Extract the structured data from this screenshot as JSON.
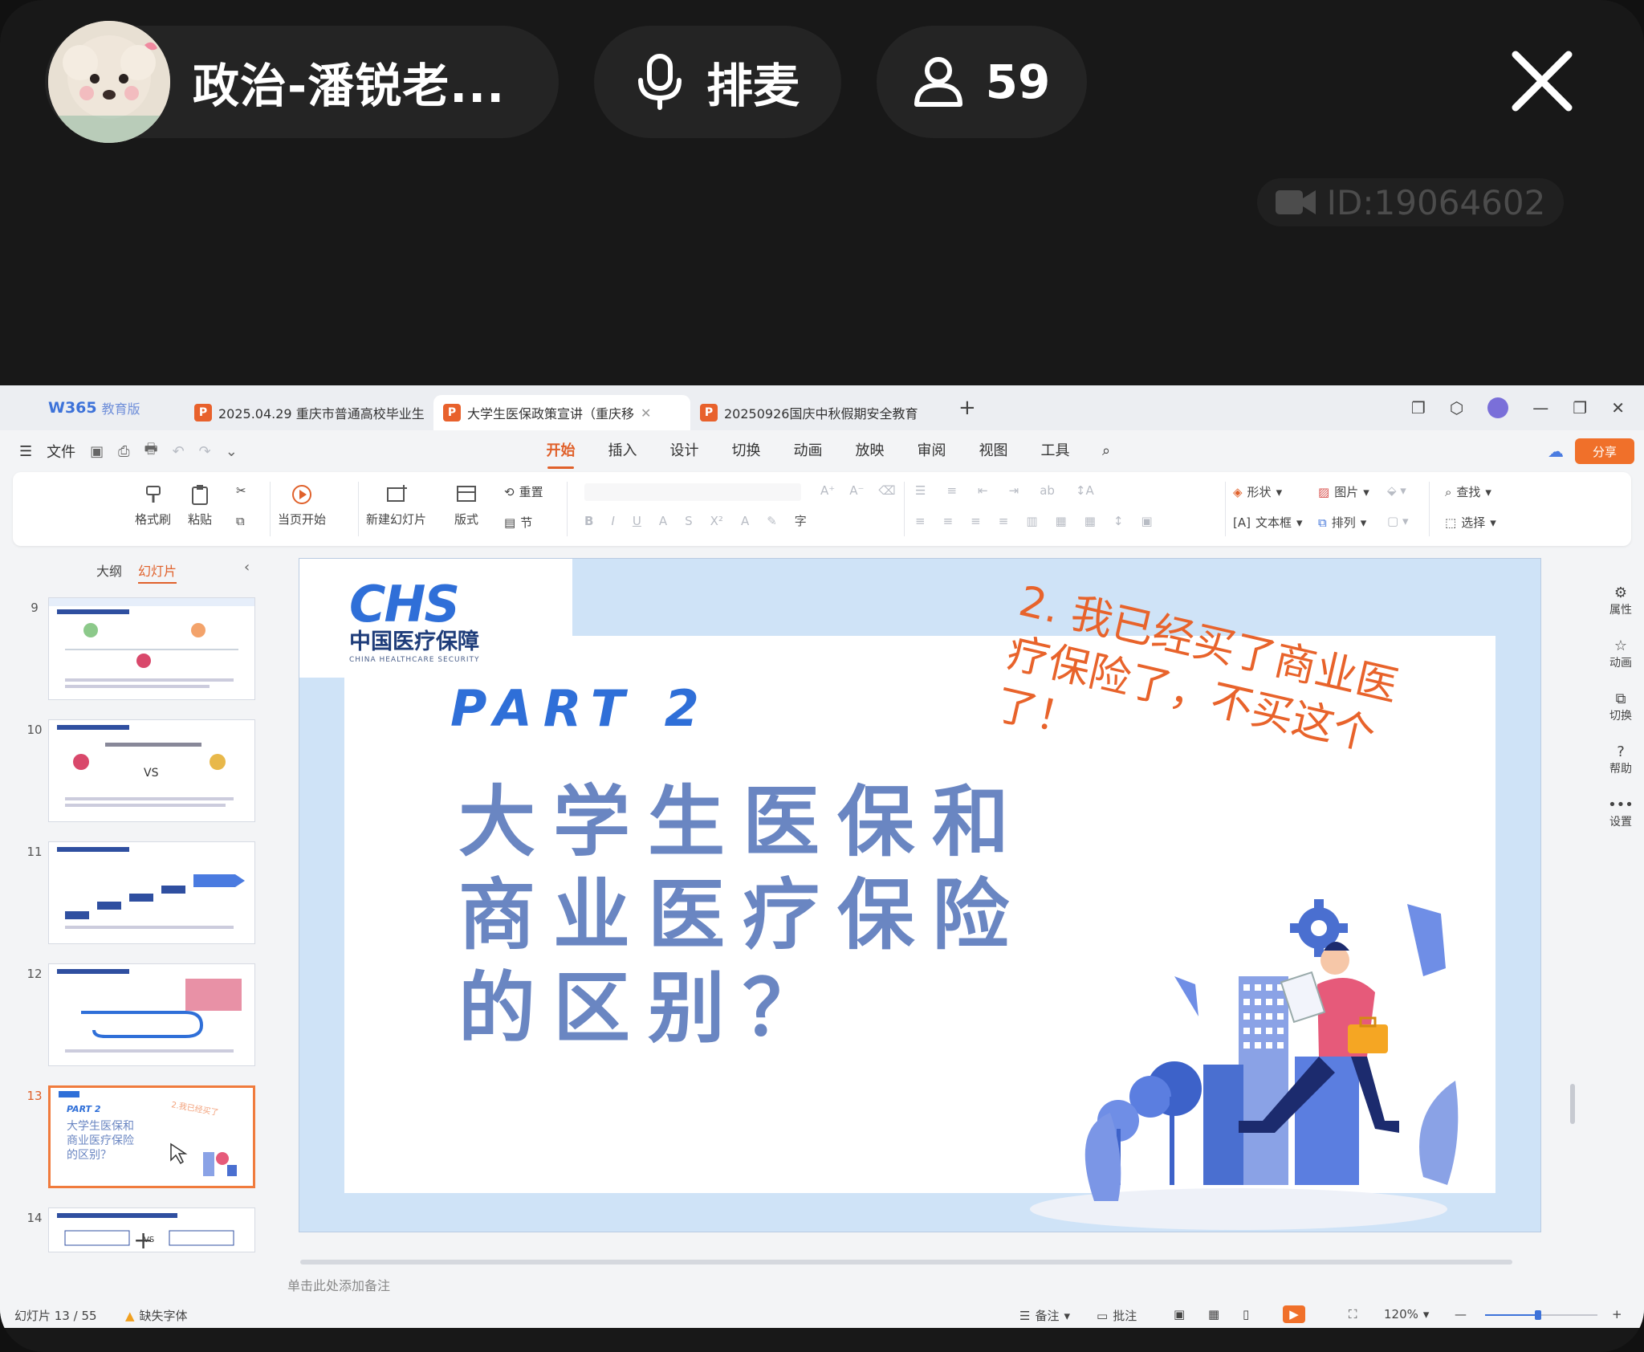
{
  "live": {
    "host_name": "政治-潘锐老...",
    "mic_label": "排麦",
    "viewer_count": "59",
    "room_id": "ID:19064602"
  },
  "wps": {
    "app_logo": "W365",
    "app_edition": "教育版",
    "tabs": [
      {
        "title": "2025.04.29 重庆市普通高校毕业生",
        "active": false
      },
      {
        "title": "大学生医保政策宣讲（重庆移",
        "active": true
      },
      {
        "title": "20250926国庆中秋假期安全教育",
        "active": false
      }
    ],
    "file_menu": "文件",
    "menu_tabs": [
      "开始",
      "插入",
      "设计",
      "切换",
      "动画",
      "放映",
      "审阅",
      "视图",
      "工具"
    ],
    "active_menu": "开始",
    "share_label": "分享",
    "ribbon": {
      "format_painter": "格式刷",
      "paste": "粘贴",
      "play_current": "当页开始",
      "new_slide": "新建幻灯片",
      "layout": "版式",
      "reset": "重置",
      "section": "节",
      "shape": "形状",
      "picture": "图片",
      "textbox": "文本框",
      "arrange": "排列",
      "find": "查找",
      "select": "选择"
    },
    "left_panel": {
      "tab_outline": "大纲",
      "tab_slides": "幻灯片",
      "slide_numbers": [
        "9",
        "10",
        "11",
        "12",
        "13",
        "14"
      ],
      "selected": "13",
      "thumb13_part": "PART 2",
      "thumb13_title": "大学生医保和\n商业医疗保险\n的区别？"
    },
    "slide": {
      "logo_letters": "CHS",
      "logo_cn": "中国医疗保障",
      "logo_en": "CHINA HEALTHCARE SECURITY",
      "part_label": "PART  2",
      "title": "大学生医保和\n商业医疗保险\n的区别？",
      "annotation": "2. 我已经买了商业医\n疗保险了，不买这个\n了！"
    },
    "notes_placeholder": "单击此处添加备注",
    "right_rail": [
      "属性",
      "动画",
      "切换",
      "帮助",
      "设置"
    ],
    "status": {
      "slide_counter": "幻灯片 13 / 55",
      "missing_font": "缺失字体",
      "notes": "备注",
      "comments": "批注",
      "zoom": "120%"
    },
    "colors": {
      "accent": "#e0612b",
      "title_blue": "#6a86c2",
      "part_blue": "#2f6fd8",
      "annotation": "#e8632b"
    }
  }
}
